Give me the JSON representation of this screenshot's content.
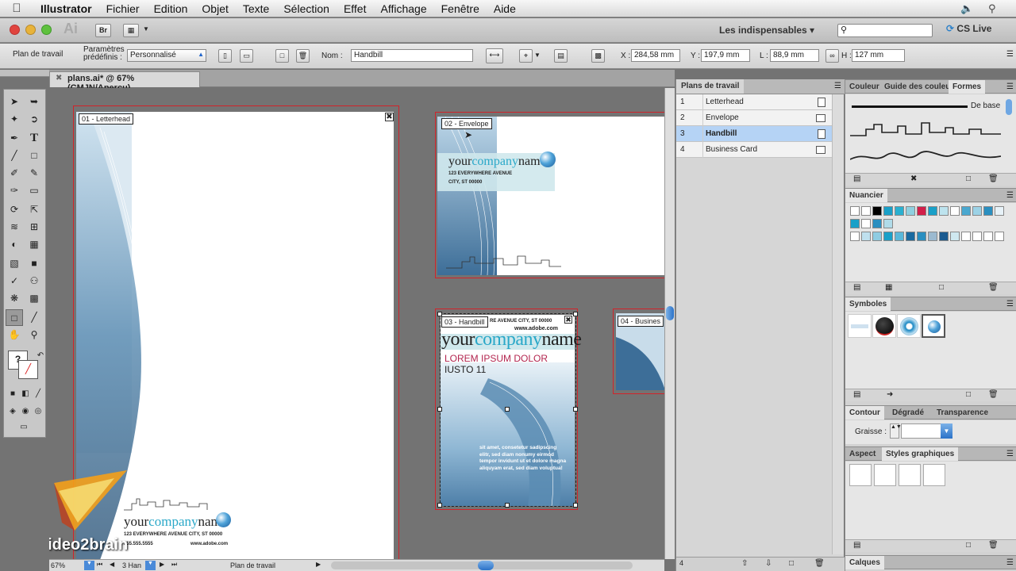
{
  "menubar": {
    "app": "Illustrator",
    "items": [
      "Fichier",
      "Edition",
      "Objet",
      "Texte",
      "Sélection",
      "Effet",
      "Affichage",
      "Fenêtre",
      "Aide"
    ]
  },
  "appbar": {
    "logo": "Ai",
    "bridge": "Br",
    "workspace": "Les indispensables",
    "cslive": "CS Live"
  },
  "control": {
    "plan_label": "Plan de travail",
    "preset_label": "Paramètres prédéfinis :",
    "preset_value": "Personnalisé",
    "name_label": "Nom :",
    "name_value": "Handbill",
    "x_label": "X :",
    "x_value": "284,58 mm",
    "y_label": "Y :",
    "y_value": "197,9 mm",
    "w_label": "L :",
    "w_value": "88,9 mm",
    "h_label": "H :",
    "h_value": "127 mm"
  },
  "document": {
    "tab": "plans.ai* @ 67% (CMJN/Aperçu)"
  },
  "canvas": {
    "labels": [
      "01 - Letterhead",
      "02 - Envelope",
      "03 - Handbill",
      "04 - Busines"
    ],
    "company_prefix": "your",
    "company_mid": "company",
    "company_suffix": "name",
    "envelope_addr1": "123 EVERYWHERE AVENUE",
    "envelope_addr2": "CITY, ST 00000",
    "letter_addr": "123  EVERYWHERE  AVENUE  CITY,  ST  00000",
    "letter_phone": "555.555.5555",
    "letter_web": "www.adobe.com",
    "hb_header": "RE AVENUE CITY, ST 00000",
    "hb_web": "www.adobe.com",
    "hb_heading1": "LOREM IPSUM DOLOR",
    "hb_heading2": "IUSTO 11",
    "hb_body": "sit amet, consetetur sadipscing elitr, sed diam nonumy eirmod tempor invidunt ut et dolore magna aliquyam erat, sed diam voluptua!"
  },
  "statusbar": {
    "zoom": "67%",
    "artboard_nav": "3 Han",
    "mode": "Plan de travail"
  },
  "artboards_panel": {
    "title": "Plans de travail",
    "rows": [
      {
        "n": "1",
        "name": "Letterhead"
      },
      {
        "n": "2",
        "name": "Envelope"
      },
      {
        "n": "3",
        "name": "Handbill"
      },
      {
        "n": "4",
        "name": "Business Card"
      }
    ],
    "count": "4"
  },
  "right_dock": {
    "tabs1": [
      "Couleur",
      "Guide des couleu",
      "Formes"
    ],
    "brush_default": "De base",
    "swatches": "Nuancier",
    "symbols": "Symboles",
    "tabs2": [
      "Contour",
      "Dégradé",
      "Transparence"
    ],
    "weight_label": "Graisse :",
    "tabs3": [
      "Aspect",
      "Styles graphiques"
    ],
    "calques": "Calques"
  },
  "watermark": "video2brain",
  "colors": {
    "accent": "#2aa8c8",
    "artboard_border": "#d2232a",
    "heading_red": "#b3254f"
  }
}
